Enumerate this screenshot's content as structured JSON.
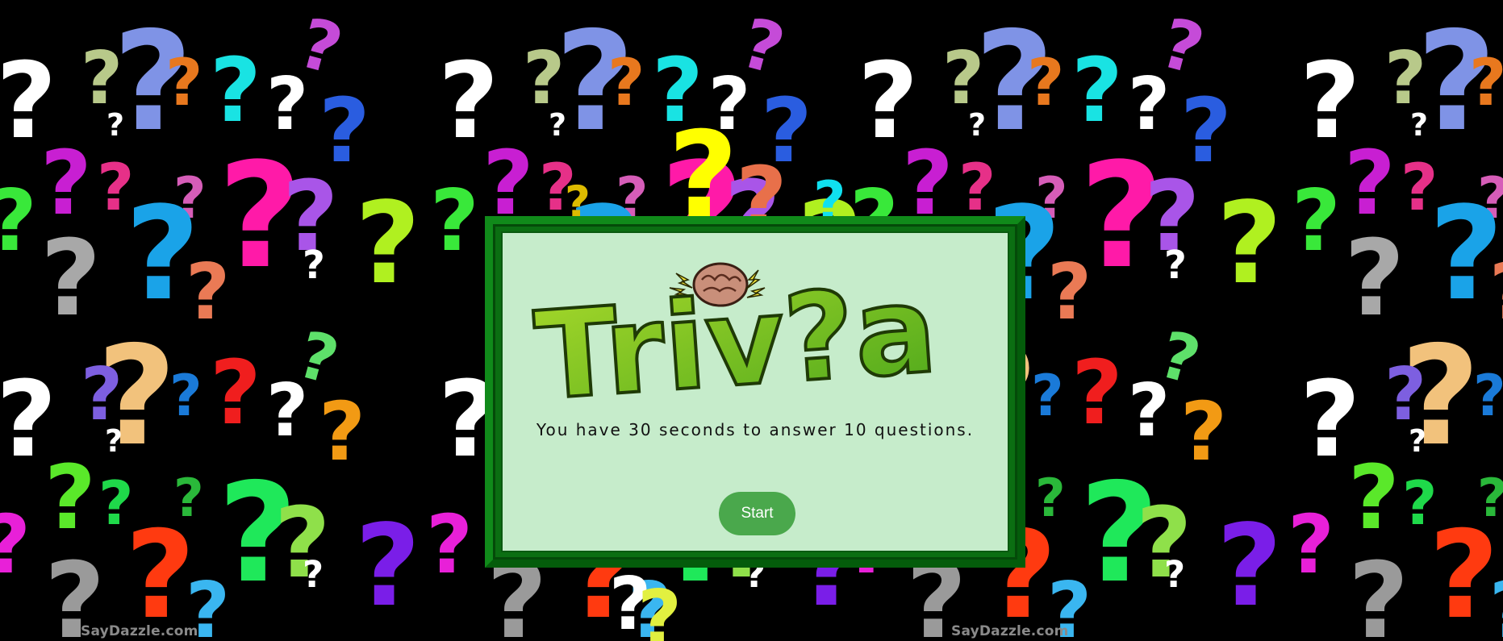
{
  "background": {
    "color": "#000000",
    "pattern_icon": "question-mark-icon",
    "watermark_text": "SayDazzle.com"
  },
  "modal": {
    "logo": {
      "text": "Triv?a",
      "brain_icon": "brain-icon",
      "colors": {
        "letters": "#7cc524",
        "outline": "#1f3a06",
        "brain": "#c98f7a",
        "sparks": "#f1e63b"
      }
    },
    "instructions": "You have 30 seconds to answer 10 questions.",
    "start_label": "Start",
    "colors": {
      "frame": "#0b6e12",
      "panel": "#c6eccb",
      "button": "#4aa84c"
    }
  }
}
